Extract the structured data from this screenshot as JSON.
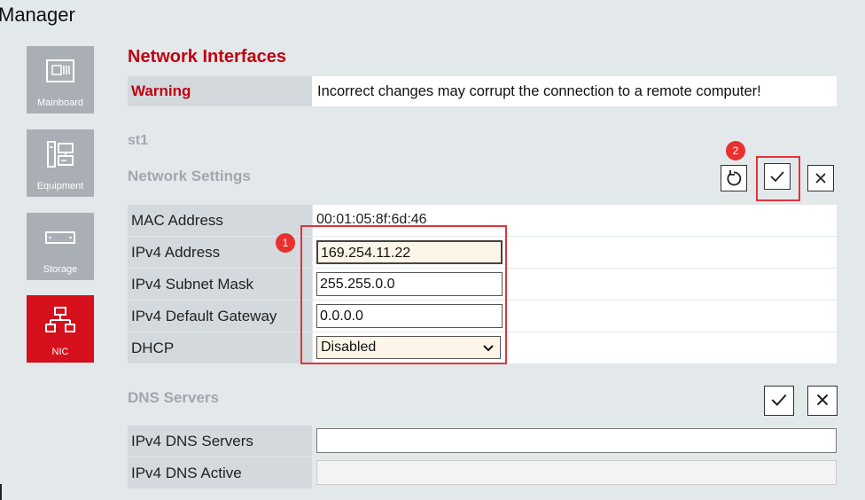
{
  "app": {
    "title": "Manager"
  },
  "sidebar": {
    "items": [
      {
        "label": "Mainboard",
        "icon": "mainboard-icon",
        "active": false
      },
      {
        "label": "Equipment",
        "icon": "equipment-icon",
        "active": false
      },
      {
        "label": "Storage",
        "icon": "storage-icon",
        "active": false
      },
      {
        "label": "NIC",
        "icon": "network-icon",
        "active": true
      }
    ]
  },
  "section": {
    "title": "Network Interfaces",
    "warning_label": "Warning",
    "warning_message": "Incorrect changes may corrupt the connection to a remote computer!"
  },
  "interface": {
    "name": "st1"
  },
  "network_settings": {
    "heading": "Network Settings",
    "rows": [
      {
        "label": "MAC Address",
        "value": "00:01:05:8f:6d:46"
      },
      {
        "label": "IPv4 Address",
        "value": "169.254.11.22"
      },
      {
        "label": "IPv4 Subnet Mask",
        "value": "255.255.0.0"
      },
      {
        "label": "IPv4 Default Gateway",
        "value": "0.0.0.0"
      },
      {
        "label": "DHCP",
        "value": "Disabled"
      }
    ]
  },
  "dns": {
    "heading": "DNS Servers",
    "rows": [
      {
        "label": "IPv4 DNS Servers",
        "value": ""
      },
      {
        "label": "IPv4 DNS Active",
        "value": ""
      }
    ]
  },
  "annotations": {
    "badge1": "1",
    "badge2": "2"
  },
  "colors": {
    "accent": "#d50f1c",
    "highlight": "#e0343b",
    "sidebar": "#a9afb4"
  }
}
